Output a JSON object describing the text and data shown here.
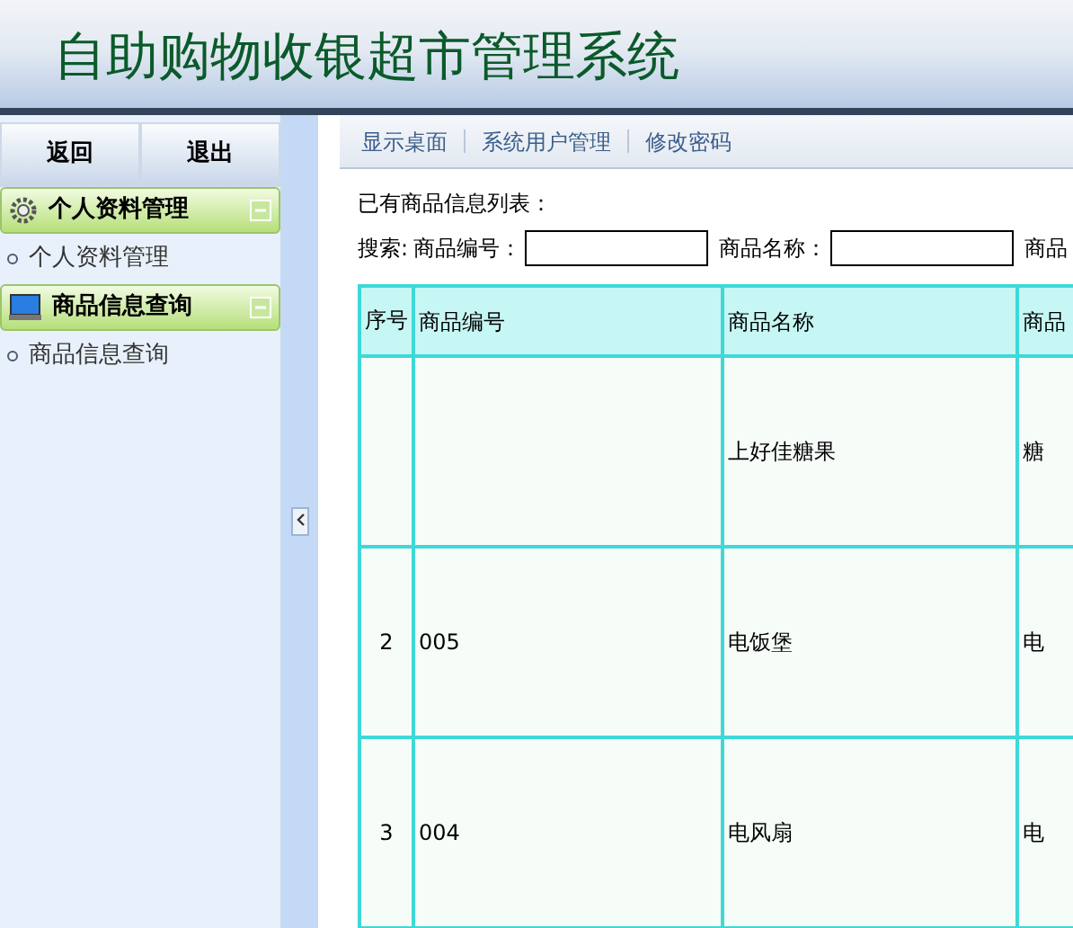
{
  "header": {
    "title": "自助购物收银超市管理系统"
  },
  "sidebar": {
    "buttons": [
      "返回",
      "退出"
    ],
    "groups": [
      {
        "title": "个人资料管理",
        "kind": "gear",
        "expanded": true,
        "items": [
          "个人资料管理"
        ]
      },
      {
        "title": "商品信息查询",
        "kind": "monitor",
        "expanded": true,
        "items": [
          "商品信息查询"
        ]
      }
    ]
  },
  "tabs": [
    "显示桌面",
    "系统用户管理",
    "修改密码"
  ],
  "content": {
    "heading": "已有商品信息列表：",
    "search_label": "搜索:",
    "fields": [
      {
        "label": "商品编号："
      },
      {
        "label": "商品名称："
      }
    ],
    "field_cut": "商品"
  },
  "table": {
    "columns": [
      "序号",
      "商品编号",
      "商品名称",
      "商品"
    ],
    "rows": [
      {
        "cells": [
          "",
          "",
          "上好佳糖果",
          "糖"
        ]
      },
      {
        "cells": [
          "2",
          "005",
          "电饭堡",
          "电"
        ]
      },
      {
        "cells": [
          "3",
          "004",
          "电风扇",
          "电"
        ]
      }
    ]
  }
}
